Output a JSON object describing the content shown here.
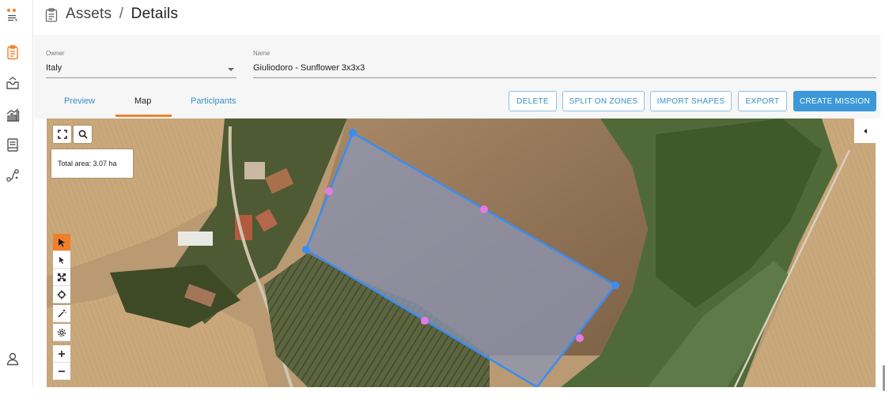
{
  "sidebar": {
    "items": [
      {
        "icon": "app-menu-icon"
      },
      {
        "icon": "assets-clipboard-icon"
      },
      {
        "icon": "missions-inbox-icon"
      },
      {
        "icon": "analytics-chart-icon"
      },
      {
        "icon": "reports-icon"
      },
      {
        "icon": "routes-icon"
      },
      {
        "icon": "user-profile-icon"
      }
    ],
    "accent": "#f07f2a"
  },
  "header": {
    "section": "Assets",
    "separator": "/",
    "page": "Details"
  },
  "form": {
    "owner_label": "Owner",
    "owner_value": "Italy",
    "name_label": "Name",
    "name_value": "Giuliodoro - Sunflower 3x3x3"
  },
  "tabs": [
    {
      "label": "Preview"
    },
    {
      "label": "Map"
    },
    {
      "label": "Participants"
    }
  ],
  "active_tab": "Map",
  "actions": {
    "delete": "DELETE",
    "split": "SPLIT ON ZONES",
    "import": "IMPORT SHAPES",
    "export": "EXPORT",
    "create": "CREATE MISSION"
  },
  "map": {
    "total_area": "Total area: 3.07 ha",
    "polygon_color": "#3b8df0",
    "midpoint_color": "#e57ae6",
    "tools": [
      "select-tool-icon",
      "direct-select-icon",
      "expand-icon",
      "move-icon",
      "magic-wand-icon",
      "settings-icon",
      "zoom-in-icon",
      "zoom-out-icon"
    ]
  }
}
